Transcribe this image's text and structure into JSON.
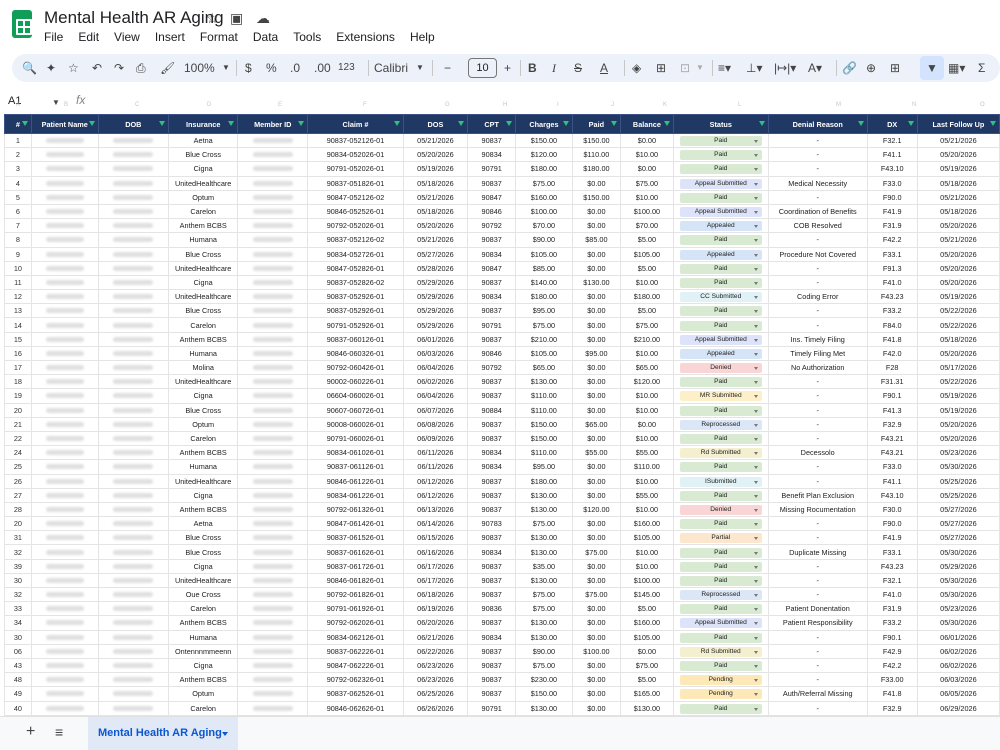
{
  "app": {
    "title": "Mental Health AR Aging"
  },
  "menu": [
    "File",
    "Edit",
    "View",
    "Insert",
    "Format",
    "Data",
    "Tools",
    "Extensions",
    "Help"
  ],
  "toolbar": {
    "zoom": "100%",
    "currency": "$",
    "percent": "%",
    "dec_less": ".0",
    "dec_more": ".00",
    "format_more": "123",
    "font": "Calibri",
    "font_size": "10"
  },
  "formula_bar": {
    "name_box": "A1",
    "fx": "fx"
  },
  "col_letters": [
    "A",
    "B",
    "C",
    "D",
    "E",
    "F",
    "G",
    "H",
    "I",
    "J",
    "K",
    "L",
    "M",
    "N",
    "O",
    "P",
    "Q"
  ],
  "headers": [
    "#",
    "Patient Name",
    "DOB",
    "Insurance",
    "Member ID",
    "Claim #",
    "DOS",
    "CPT",
    "Charges",
    "Paid",
    "Balance",
    "Status",
    "Denial Reason",
    "DX",
    "Last Follow Up"
  ],
  "status_colors": {
    "Paid": "#d9ead3",
    "Appeal Submitted": "#dde3f8",
    "Appealed": "#d6e4f7",
    "CC Submitted": "#e0f2f5",
    "Denied": "#f9d6d5",
    "MR Submitted": "#fdf0c8",
    "Reprocessed": "#dbe6f6",
    "Pending": "#fde8b8",
    "Partial": "#fce6cd",
    "Submitted": "#fde8d4",
    "ISubmitted": "#e0f2f5",
    "Rd Submitted": "#f3efcf"
  },
  "rows": [
    [
      "1",
      "",
      "",
      "Aetna",
      "",
      "90837-052126-01",
      "05/21/2026",
      "90837",
      "$150.00",
      "$150.00",
      "$0.00",
      "Paid",
      "-",
      "F32.1",
      "05/21/2026"
    ],
    [
      "2",
      "",
      "",
      "Blue Cross",
      "",
      "90834-052026-01",
      "05/20/2026",
      "90834",
      "$120.00",
      "$110.00",
      "$10.00",
      "Paid",
      "-",
      "F41.1",
      "05/20/2026"
    ],
    [
      "3",
      "",
      "",
      "Cigna",
      "",
      "90791-052026-01",
      "05/19/2026",
      "90791",
      "$180.00",
      "$180.00",
      "$0.00",
      "Paid",
      "-",
      "F43.10",
      "05/19/2026"
    ],
    [
      "4",
      "",
      "",
      "UnitedHealthcare",
      "",
      "90837-051826-01",
      "05/18/2026",
      "90837",
      "$75.00",
      "$0.00",
      "$75.00",
      "Appeal Submitted",
      "Medical Necessity",
      "F33.0",
      "05/18/2026"
    ],
    [
      "5",
      "",
      "",
      "Optum",
      "",
      "90847-052126-02",
      "05/21/2026",
      "90847",
      "$160.00",
      "$150.00",
      "$10.00",
      "Paid",
      "-",
      "F90.0",
      "05/21/2026"
    ],
    [
      "6",
      "",
      "",
      "Carelon",
      "",
      "90846-052526-01",
      "05/18/2026",
      "90846",
      "$100.00",
      "$0.00",
      "$100.00",
      "Appeal Submitted",
      "Coordination of Benefits",
      "F41.9",
      "05/18/2026"
    ],
    [
      "7",
      "",
      "",
      "Anthem BCBS",
      "",
      "90792-052026-01",
      "05/20/2026",
      "90792",
      "$70.00",
      "$0.00",
      "$70.00",
      "Appealed",
      "COB Resolved",
      "F31.9",
      "05/20/2026"
    ],
    [
      "8",
      "",
      "",
      "Humana",
      "",
      "90837-052126-02",
      "05/21/2026",
      "90837",
      "$90.00",
      "$85.00",
      "$5.00",
      "Paid",
      "-",
      "F42.2",
      "05/21/2026"
    ],
    [
      "9",
      "",
      "",
      "Blue Cross",
      "",
      "90834-052726-01",
      "05/27/2026",
      "90834",
      "$105.00",
      "$0.00",
      "$105.00",
      "Appealed",
      "Procedure Not Covered",
      "F33.1",
      "05/20/2026"
    ],
    [
      "10",
      "",
      "",
      "UnitedHealthcare",
      "",
      "90847-052826-01",
      "05/28/2026",
      "90847",
      "$85.00",
      "$0.00",
      "$5.00",
      "Paid",
      "-",
      "F91.3",
      "05/20/2026"
    ],
    [
      "11",
      "",
      "",
      "Cigna",
      "",
      "90837-052826-02",
      "05/29/2026",
      "90837",
      "$140.00",
      "$130.00",
      "$10.00",
      "Paid",
      "-",
      "F41.0",
      "05/20/2026"
    ],
    [
      "12",
      "",
      "",
      "UnitedHealthcare",
      "",
      "90837-052926-01",
      "05/29/2026",
      "90834",
      "$180.00",
      "$0.00",
      "$180.00",
      "CC Submitted",
      "Coding Error",
      "F43.23",
      "05/19/2026"
    ],
    [
      "13",
      "",
      "",
      "Blue Cross",
      "",
      "90837-052926-01",
      "05/29/2026",
      "90837",
      "$95.00",
      "$0.00",
      "$5.00",
      "Paid",
      "-",
      "F33.2",
      "05/22/2026"
    ],
    [
      "14",
      "",
      "",
      "Carelon",
      "",
      "90791-052926-01",
      "05/29/2026",
      "90791",
      "$75.00",
      "$0.00",
      "$75.00",
      "Paid",
      "-",
      "F84.0",
      "05/22/2026"
    ],
    [
      "15",
      "",
      "",
      "Anthem BCBS",
      "",
      "90837-060126-01",
      "06/01/2026",
      "90837",
      "$210.00",
      "$0.00",
      "$210.00",
      "Appeal Submitted",
      "Ins. Timely Filing",
      "F41.8",
      "05/18/2026"
    ],
    [
      "16",
      "",
      "",
      "Humana",
      "",
      "90846-060326-01",
      "06/03/2026",
      "90846",
      "$105.00",
      "$95.00",
      "$10.00",
      "Appealed",
      "Timely Filing Met",
      "F42.0",
      "05/20/2026"
    ],
    [
      "17",
      "",
      "",
      "Molina",
      "",
      "90792-060426-01",
      "06/04/2026",
      "90792",
      "$65.00",
      "$0.00",
      "$65.00",
      "Denied",
      "No Authorization",
      "F28",
      "05/17/2026"
    ],
    [
      "18",
      "",
      "",
      "UnitedHealthcare",
      "",
      "90002-060226-01",
      "06/02/2026",
      "90837",
      "$130.00",
      "$0.00",
      "$120.00",
      "Paid",
      "-",
      "F31.31",
      "05/22/2026"
    ],
    [
      "19",
      "",
      "",
      "Cigna",
      "",
      "06604-060026-01",
      "06/04/2026",
      "90837",
      "$110.00",
      "$0.00",
      "$10.00",
      "MR Submitted",
      "-",
      "F90.1",
      "05/19/2026"
    ],
    [
      "20",
      "",
      "",
      "Blue Cross",
      "",
      "90607-060726-01",
      "06/07/2026",
      "90884",
      "$110.00",
      "$0.00",
      "$10.00",
      "Paid",
      "-",
      "F41.3",
      "05/19/2026"
    ],
    [
      "21",
      "",
      "",
      "Optum",
      "",
      "90008-060026-01",
      "06/08/2026",
      "90837",
      "$150.00",
      "$65.00",
      "$0.00",
      "Reprocessed",
      "-",
      "F32.9",
      "05/20/2026"
    ],
    [
      "22",
      "",
      "",
      "Carelon",
      "",
      "90791-060026-01",
      "06/09/2026",
      "90837",
      "$150.00",
      "$0.00",
      "$10.00",
      "Paid",
      "-",
      "F43.21",
      "05/20/2026"
    ],
    [
      "24",
      "",
      "",
      "Anthem BCBS",
      "",
      "90834-061026-01",
      "06/11/2026",
      "90834",
      "$110.00",
      "$55.00",
      "$55.00",
      "Rd Submitted",
      "Decessolo",
      "F43.21",
      "05/23/2026"
    ],
    [
      "25",
      "",
      "",
      "Humana",
      "",
      "90837-061126-01",
      "06/11/2026",
      "90834",
      "$95.00",
      "$0.00",
      "$110.00",
      "Paid",
      "-",
      "F33.0",
      "05/30/2026"
    ],
    [
      "26",
      "",
      "",
      "UnitedHealthcare",
      "",
      "90846-061226-01",
      "06/12/2026",
      "90837",
      "$180.00",
      "$0.00",
      "$10.00",
      "ISubmitted",
      "-",
      "F41.1",
      "05/25/2026"
    ],
    [
      "27",
      "",
      "",
      "Cigna",
      "",
      "90834-061226-01",
      "06/12/2026",
      "90837",
      "$130.00",
      "$0.00",
      "$55.00",
      "Paid",
      "Benefit Plan Exclusion",
      "F43.10",
      "05/25/2026"
    ],
    [
      "28",
      "",
      "",
      "Anthem BCBS",
      "",
      "90792-061326-01",
      "06/13/2026",
      "90837",
      "$130.00",
      "$120.00",
      "$10.00",
      "Denied",
      "Missing Rocumentation",
      "F30.0",
      "05/27/2026"
    ],
    [
      "20",
      "",
      "",
      "Aetna",
      "",
      "90847-061426-01",
      "06/14/2026",
      "90783",
      "$75.00",
      "$0.00",
      "$160.00",
      "Paid",
      "-",
      "F90.0",
      "05/27/2026"
    ],
    [
      "31",
      "",
      "",
      "Blue Cross",
      "",
      "90837-061526-01",
      "06/15/2026",
      "90837",
      "$130.00",
      "$0.00",
      "$105.00",
      "Partial",
      "-",
      "F41.9",
      "05/27/2026"
    ],
    [
      "32",
      "",
      "",
      "Blue Cross",
      "",
      "90837-061626-01",
      "06/16/2026",
      "90834",
      "$130.00",
      "$75.00",
      "$10.00",
      "Paid",
      "Duplicate Missing",
      "F33.1",
      "05/30/2026"
    ],
    [
      "39",
      "",
      "",
      "Cigna",
      "",
      "90837-061726-01",
      "06/17/2026",
      "90837",
      "$35.00",
      "$0.00",
      "$10.00",
      "Paid",
      "-",
      "F43.23",
      "05/29/2026"
    ],
    [
      "30",
      "",
      "",
      "UnitedHealthcare",
      "",
      "90846-061826-01",
      "06/17/2026",
      "90837",
      "$130.00",
      "$0.00",
      "$100.00",
      "Paid",
      "-",
      "F32.1",
      "05/30/2026"
    ],
    [
      "32",
      "",
      "",
      "Oue Cross",
      "",
      "90792-061826-01",
      "06/18/2026",
      "90837",
      "$75.00",
      "$75.00",
      "$145.00",
      "Reprocessed",
      "-",
      "F41.0",
      "05/30/2026"
    ],
    [
      "33",
      "",
      "",
      "Carelon",
      "",
      "90791-061926-01",
      "06/19/2026",
      "90836",
      "$75.00",
      "$0.00",
      "$5.00",
      "Paid",
      "Patient Donentation",
      "F31.9",
      "05/23/2026"
    ],
    [
      "34",
      "",
      "",
      "Anthem BCBS",
      "",
      "90792-062026-01",
      "06/20/2026",
      "90837",
      "$130.00",
      "$0.00",
      "$160.00",
      "Appeal Submitted",
      "Patient Responsibility",
      "F33.2",
      "05/30/2026"
    ],
    [
      "30",
      "",
      "",
      "Humana",
      "",
      "90834-062126-01",
      "06/21/2026",
      "90834",
      "$130.00",
      "$0.00",
      "$105.00",
      "Paid",
      "-",
      "F90.1",
      "06/01/2026"
    ],
    [
      "06",
      "",
      "",
      "Ontennnmmeenn",
      "",
      "90837-062226-01",
      "06/22/2026",
      "90837",
      "$90.00",
      "$100.00",
      "$0.00",
      "Rd Submitted",
      "-",
      "F42.9",
      "06/02/2026"
    ],
    [
      "43",
      "",
      "",
      "Cigna",
      "",
      "90847-062226-01",
      "06/23/2026",
      "90837",
      "$75.00",
      "$0.00",
      "$75.00",
      "Paid",
      "-",
      "F42.2",
      "06/02/2026"
    ],
    [
      "48",
      "",
      "",
      "Anthem BCBS",
      "",
      "90792-062326-01",
      "06/23/2026",
      "90837",
      "$230.00",
      "$0.00",
      "$5.00",
      "Pending",
      "-",
      "F33.00",
      "06/03/2026"
    ],
    [
      "49",
      "",
      "",
      "Optum",
      "",
      "90837-062526-01",
      "06/25/2026",
      "90837",
      "$150.00",
      "$0.00",
      "$165.00",
      "Pending",
      "Auth/Referral Missing",
      "F41.8",
      "06/05/2026"
    ],
    [
      "40",
      "",
      "",
      "Carelon",
      "",
      "90846-062626-01",
      "06/26/2026",
      "90791",
      "$130.00",
      "$0.00",
      "$130.00",
      "Paid",
      "-",
      "F32.9",
      "06/29/2026"
    ]
  ],
  "sheet_tab": "Mental Health AR Aging"
}
